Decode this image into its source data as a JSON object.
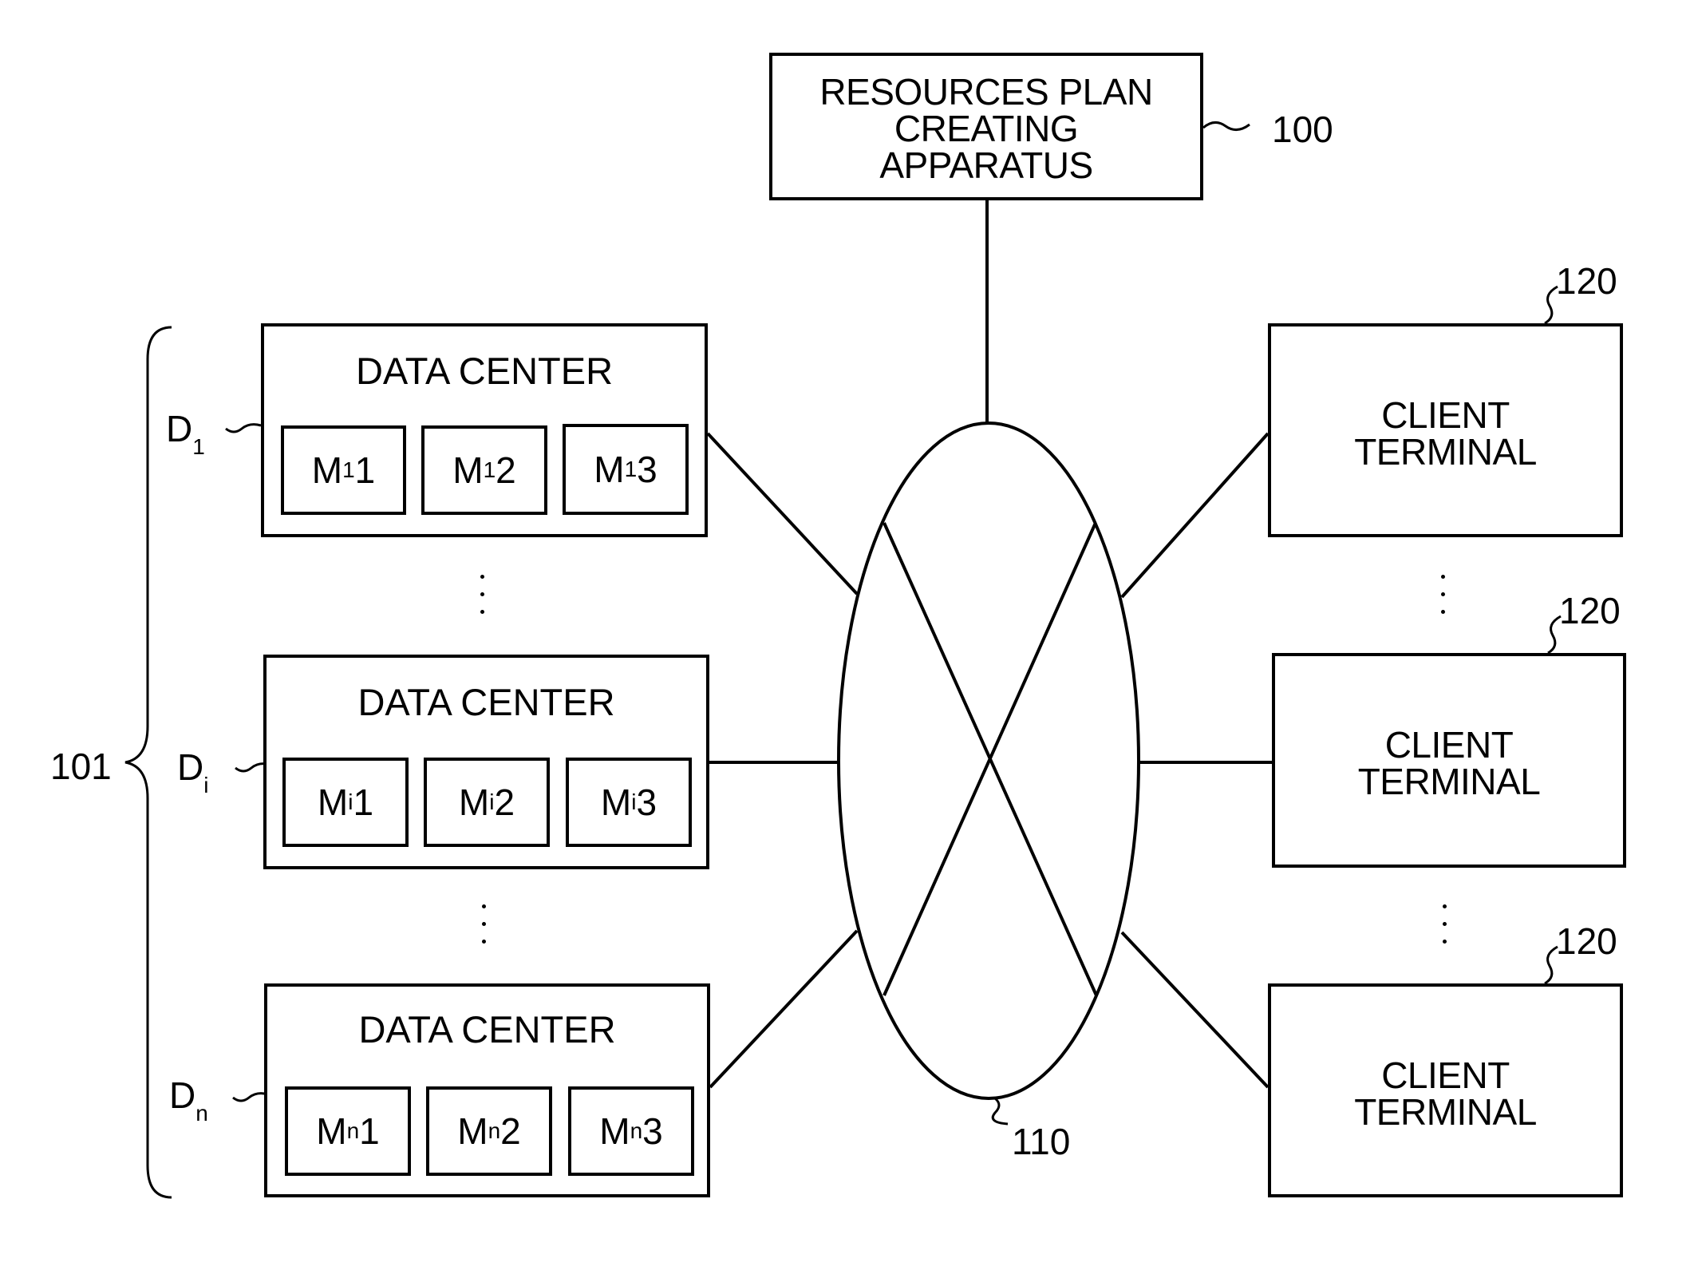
{
  "figure": {
    "apparatus": {
      "lines": [
        "RESOURCES PLAN",
        "CREATING",
        "APPARATUS"
      ],
      "ref": "100"
    },
    "network": {
      "ref": "110"
    },
    "group": {
      "ref": "101"
    },
    "data_centers": [
      {
        "label_main": "D",
        "label_sub": "1",
        "title": "DATA CENTER",
        "machines": [
          {
            "m": "M",
            "sub": "1",
            "n": "1"
          },
          {
            "m": "M",
            "sub": "1",
            "n": "2"
          },
          {
            "m": "M",
            "sub": "1",
            "n": "3"
          }
        ]
      },
      {
        "label_main": "D",
        "label_sub": "i",
        "title": "DATA CENTER",
        "machines": [
          {
            "m": "M",
            "sub": "i",
            "n": "1"
          },
          {
            "m": "M",
            "sub": "i",
            "n": "2"
          },
          {
            "m": "M",
            "sub": "i",
            "n": "3"
          }
        ]
      },
      {
        "label_main": "D",
        "label_sub": "n",
        "title": "DATA CENTER",
        "machines": [
          {
            "m": "M",
            "sub": "n",
            "n": "1"
          },
          {
            "m": "M",
            "sub": "n",
            "n": "2"
          },
          {
            "m": "M",
            "sub": "n",
            "n": "3"
          }
        ]
      }
    ],
    "clients": [
      {
        "lines": [
          "CLIENT",
          "TERMINAL"
        ],
        "ref": "120"
      },
      {
        "lines": [
          "CLIENT",
          "TERMINAL"
        ],
        "ref": "120"
      },
      {
        "lines": [
          "CLIENT",
          "TERMINAL"
        ],
        "ref": "120"
      }
    ]
  }
}
